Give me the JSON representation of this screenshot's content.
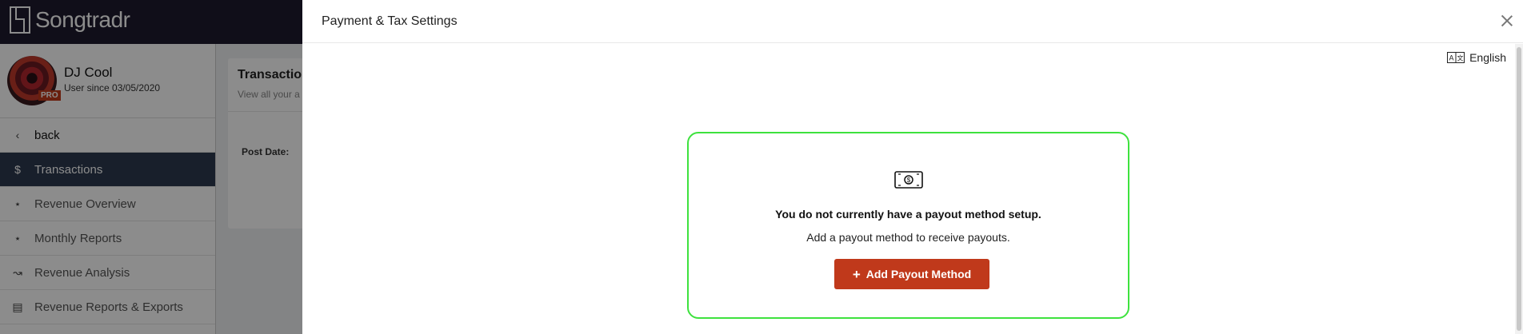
{
  "app": {
    "brand": "Songtradr"
  },
  "profile": {
    "name": "DJ Cool",
    "since": "User since 03/05/2020",
    "badge": "PRO"
  },
  "sidebar": {
    "back_label": "back",
    "items": [
      {
        "label": "Transactions",
        "icon": "dollar-icon",
        "active": true
      },
      {
        "label": "Revenue Overview",
        "icon": "network-icon"
      },
      {
        "label": "Monthly Reports",
        "icon": "network-icon"
      },
      {
        "label": "Revenue Analysis",
        "icon": "chart-icon"
      },
      {
        "label": "Revenue Reports & Exports",
        "icon": "file-icon"
      }
    ]
  },
  "main": {
    "card_title": "Transactio",
    "card_subtitle": "View all your a",
    "post_date_label": "Post Date:"
  },
  "drawer": {
    "title": "Payment & Tax Settings",
    "language": "English",
    "empty_title": "You do not currently have a payout method setup.",
    "empty_subtitle": "Add a payout method to receive payouts.",
    "add_button_label": "Add Payout Method"
  },
  "colors": {
    "accent": "#c0391b",
    "topbar": "#1e1b2e",
    "active_nav": "#2c3a4f",
    "highlight_border": "#3ee23e"
  }
}
